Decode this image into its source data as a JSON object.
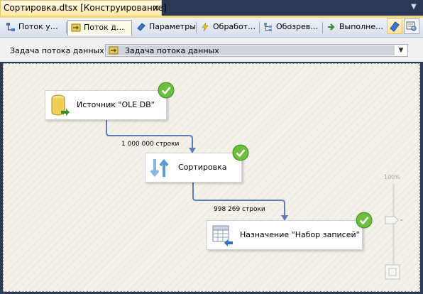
{
  "document": {
    "tab_title": "Сортировка.dtsx [Конструирование]",
    "close_glyph": "×",
    "dropdown_glyph": "▼"
  },
  "tabs": [
    {
      "label": "Поток у…",
      "icon": "control-flow-icon"
    },
    {
      "label": "Поток д…",
      "icon": "data-flow-icon",
      "active": true
    },
    {
      "label": "Параметры",
      "icon": "parameters-icon"
    },
    {
      "label": "Обработ…",
      "icon": "event-handlers-icon"
    },
    {
      "label": "Обозрев…",
      "icon": "package-explorer-icon"
    },
    {
      "label": "Выполне…",
      "icon": "progress-icon"
    }
  ],
  "task": {
    "label": "Задача потока данных:",
    "value": "Задача потока данных",
    "arrow": "▼"
  },
  "components": [
    {
      "label": "Источник \"OLE DB\"",
      "icon": "ole-db-source-icon",
      "status": "success"
    },
    {
      "label": "Сортировка",
      "icon": "sort-icon",
      "status": "success"
    },
    {
      "label": "Назначение \"Набор записей\"",
      "icon": "recordset-destination-icon",
      "status": "success"
    }
  ],
  "paths": [
    {
      "label": "1 000 000 строки"
    },
    {
      "label": "998 269 строки"
    }
  ],
  "zoom": {
    "label": "100%",
    "level_percent": 100
  },
  "colors": {
    "connector": "#5b7fb2",
    "success": "#6cbf3d",
    "active_tab": "#fffbe8",
    "title_bar": "#293955"
  }
}
